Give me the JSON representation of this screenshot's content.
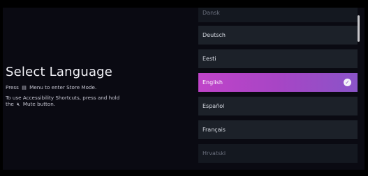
{
  "page": {
    "title": "Select Language",
    "store_mode_text_prefix": "Press",
    "store_mode_icon": "menu-icon",
    "store_mode_text_suffix": "Menu to enter Store Mode.",
    "accessibility_text_line1": "To use Accessibility Shortcuts, press and hold",
    "accessibility_text_prefix": "the",
    "accessibility_icon": "mute-icon",
    "accessibility_text_suffix": "Mute button."
  },
  "languages": [
    {
      "label": "Dansk",
      "state": "faded"
    },
    {
      "label": "Deutsch",
      "state": "normal"
    },
    {
      "label": "Eesti",
      "state": "normal"
    },
    {
      "label": "English",
      "state": "selected"
    },
    {
      "label": "Español",
      "state": "normal"
    },
    {
      "label": "Français",
      "state": "normal"
    },
    {
      "label": "Hrvatski",
      "state": "faded"
    }
  ],
  "colors": {
    "selected_gradient_start": "#c044c9",
    "selected_gradient_end": "#8a54c8",
    "item_background": "#1c2129",
    "screen_background": "#0a0a12"
  }
}
